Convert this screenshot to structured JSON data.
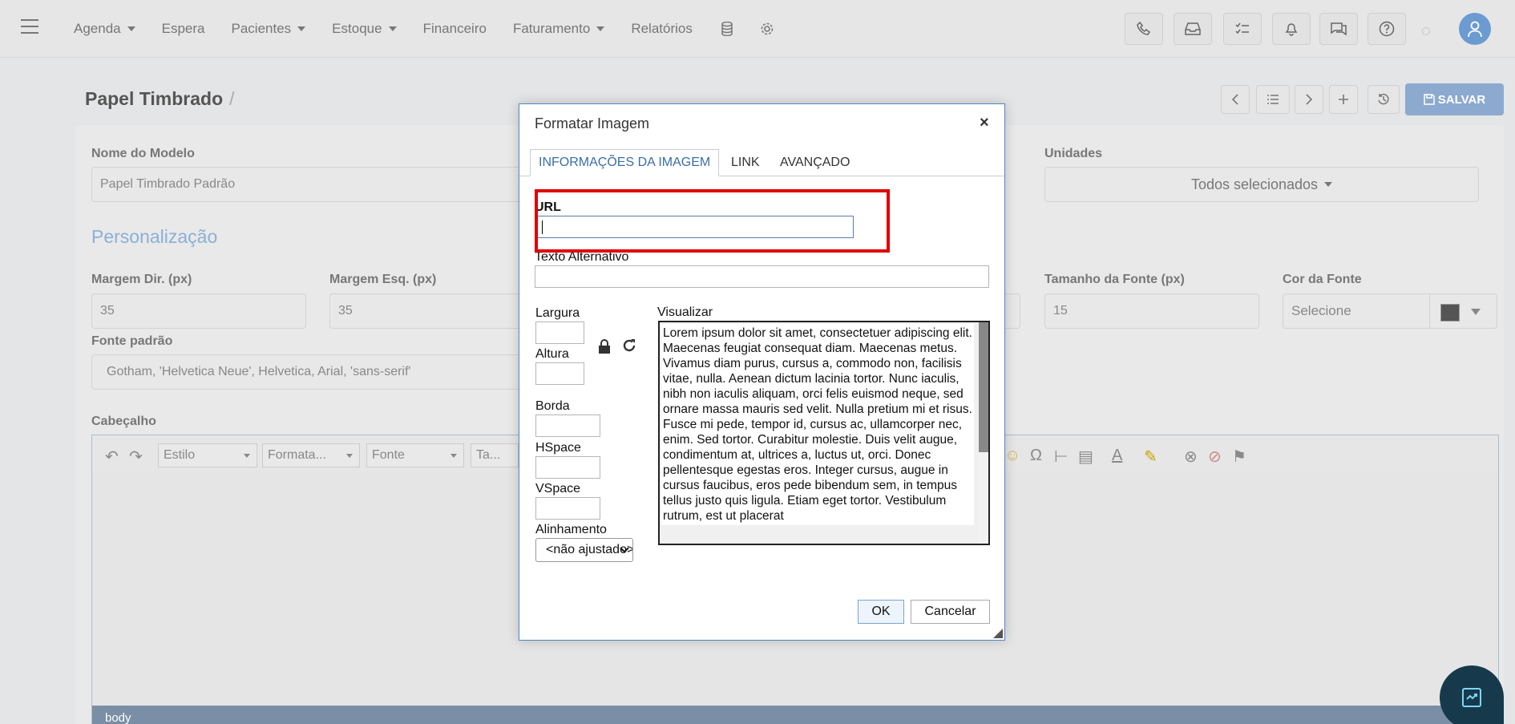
{
  "nav": {
    "items": [
      "Agenda",
      "Espera",
      "Pacientes",
      "Estoque",
      "Financeiro",
      "Faturamento",
      "Relatórios"
    ],
    "has_caret": [
      true,
      false,
      true,
      true,
      false,
      true,
      false
    ]
  },
  "page": {
    "title": "Papel Timbrado",
    "save_label": "SALVAR"
  },
  "form": {
    "nome_modelo_label": "Nome do Modelo",
    "nome_modelo_value": "Papel Timbrado Padrão",
    "unidades_label": "Unidades",
    "unidades_value": "Todos selecionados",
    "section_title": "Personalização",
    "margem_dir_label": "Margem Dir. (px)",
    "margem_dir_value": "35",
    "margem_esq_label": "Margem Esq. (px)",
    "margem_esq_value": "35",
    "tamanho_fonte_label": "Tamanho da Fonte (px)",
    "tamanho_fonte_value": "15",
    "cor_fonte_label": "Cor da Fonte",
    "cor_fonte_placeholder": "Selecione",
    "fonte_padrao_label": "Fonte padrão",
    "fonte_padrao_value": "Gotham, 'Helvetica Neue', Helvetica, Arial, 'sans-serif'",
    "cabecalho_label": "Cabeçalho"
  },
  "editor": {
    "style_select": "Estilo",
    "format_select": "Formata...",
    "font_select": "Fonte",
    "size_select": "Ta...",
    "status_path": "body"
  },
  "dialog": {
    "title": "Formatar Imagem",
    "close_symbol": "×",
    "tabs": [
      "INFORMAÇÕES DA IMAGEM",
      "LINK",
      "AVANÇADO"
    ],
    "url_label": "URL",
    "url_value": "",
    "alt_label": "Texto Alternativo",
    "largura_label": "Largura",
    "altura_label": "Altura",
    "borda_label": "Borda",
    "hspace_label": "HSpace",
    "vspace_label": "VSpace",
    "alinhamento_label": "Alinhamento",
    "alinhamento_value": "<não ajustado>",
    "visualizar_label": "Visualizar",
    "preview_text": "Lorem ipsum dolor sit amet, consectetuer adipiscing elit. Maecenas feugiat consequat diam. Maecenas metus. Vivamus diam purus, cursus a, commodo non, facilisis vitae, nulla. Aenean dictum lacinia tortor. Nunc iaculis, nibh non iaculis aliquam, orci felis euismod neque, sed ornare massa mauris sed velit. Nulla pretium mi et risus. Fusce mi pede, tempor id, cursus ac, ullamcorper nec, enim. Sed tortor. Curabitur molestie. Duis velit augue, condimentum at, ultrices a, luctus ut, orci. Donec pellentesque egestas eros. Integer cursus, augue in cursus faucibus, eros pede bibendum sem, in tempus tellus justo quis ligula. Etiam eget tortor. Vestibulum rutrum, est ut placerat",
    "ok_label": "OK",
    "cancel_label": "Cancelar"
  },
  "colors": {
    "accent": "#4e88c4",
    "highlight": "#e00000",
    "save_button": "#8ca9cf"
  }
}
